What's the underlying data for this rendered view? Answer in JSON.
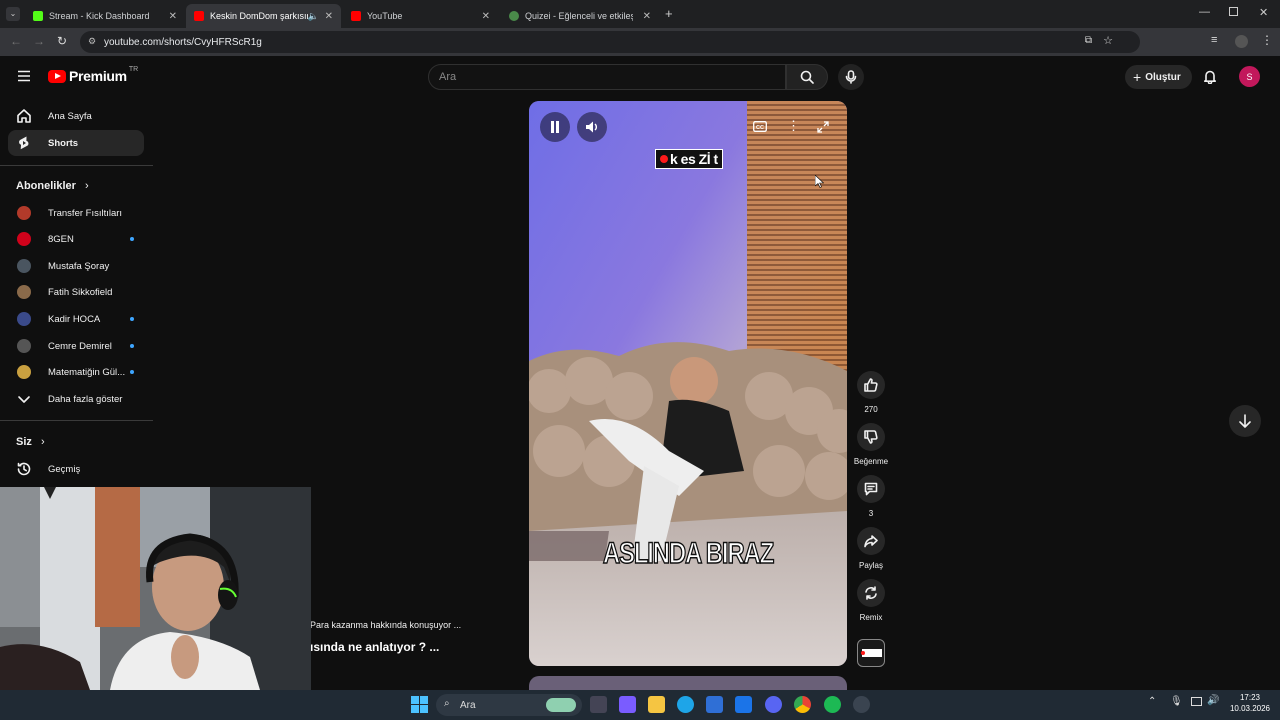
{
  "browser": {
    "tabs": [
      {
        "title": "Stream - Kick Dashboard",
        "fav_color": "#53fc18",
        "active": false
      },
      {
        "title": "Keskin DomDom şarkısında",
        "fav_color": "#ff0000",
        "active": true
      },
      {
        "title": "YouTube",
        "fav_color": "#ff0000",
        "active": false
      },
      {
        "title": "Quizei - Eğlenceli ve etkileşimli",
        "fav_color": "#4a8a4a",
        "active": false
      }
    ],
    "url": "youtube.com/shorts/CvyHFRScR1g"
  },
  "header": {
    "logo_text": "Premium",
    "country": "TR",
    "search_placeholder": "Ara",
    "create_label": "Oluştur",
    "avatar_letter": "S"
  },
  "sidebar": {
    "main": [
      {
        "label": "Ana Sayfa",
        "icon": "home-icon"
      },
      {
        "label": "Shorts",
        "icon": "shorts-icon"
      }
    ],
    "subscriptions_header": "Abonelikler",
    "subscriptions": [
      {
        "label": "Transfer Fısıltıları",
        "avatar_color": "#b23a2a",
        "new": false
      },
      {
        "label": "8GEN",
        "avatar_color": "#d0021b",
        "new": true
      },
      {
        "label": "Mustafa Şoray",
        "avatar_color": "#4a5560",
        "new": false
      },
      {
        "label": "Fatih Sikkofield",
        "avatar_color": "#8a6a4a",
        "new": false
      },
      {
        "label": "Kadir HOCA",
        "avatar_color": "#3a4a8a",
        "new": true
      },
      {
        "label": "Cemre Demirel",
        "avatar_color": "#555555",
        "new": true
      },
      {
        "label": "Matematiğin Gül...",
        "avatar_color": "#c9a040",
        "new": true
      }
    ],
    "show_more": "Daha fazla göster",
    "you_header": "Siz",
    "history": "Geçmiş"
  },
  "short": {
    "channel_logo_text": "k es Zİ t",
    "caption": "ASLINDA BIRAZ",
    "sub_title": "Para kazanma hakkında konuşuyor ...",
    "title": "ısında ne anlatıyor ? ..."
  },
  "actions": {
    "likes": "270",
    "dislike_label": "Beğenme",
    "comments": "3",
    "share_label": "Paylaş",
    "remix_label": "Remix"
  },
  "taskbar": {
    "search": "Ara",
    "time": "17:23",
    "date": "10.03.2026"
  }
}
